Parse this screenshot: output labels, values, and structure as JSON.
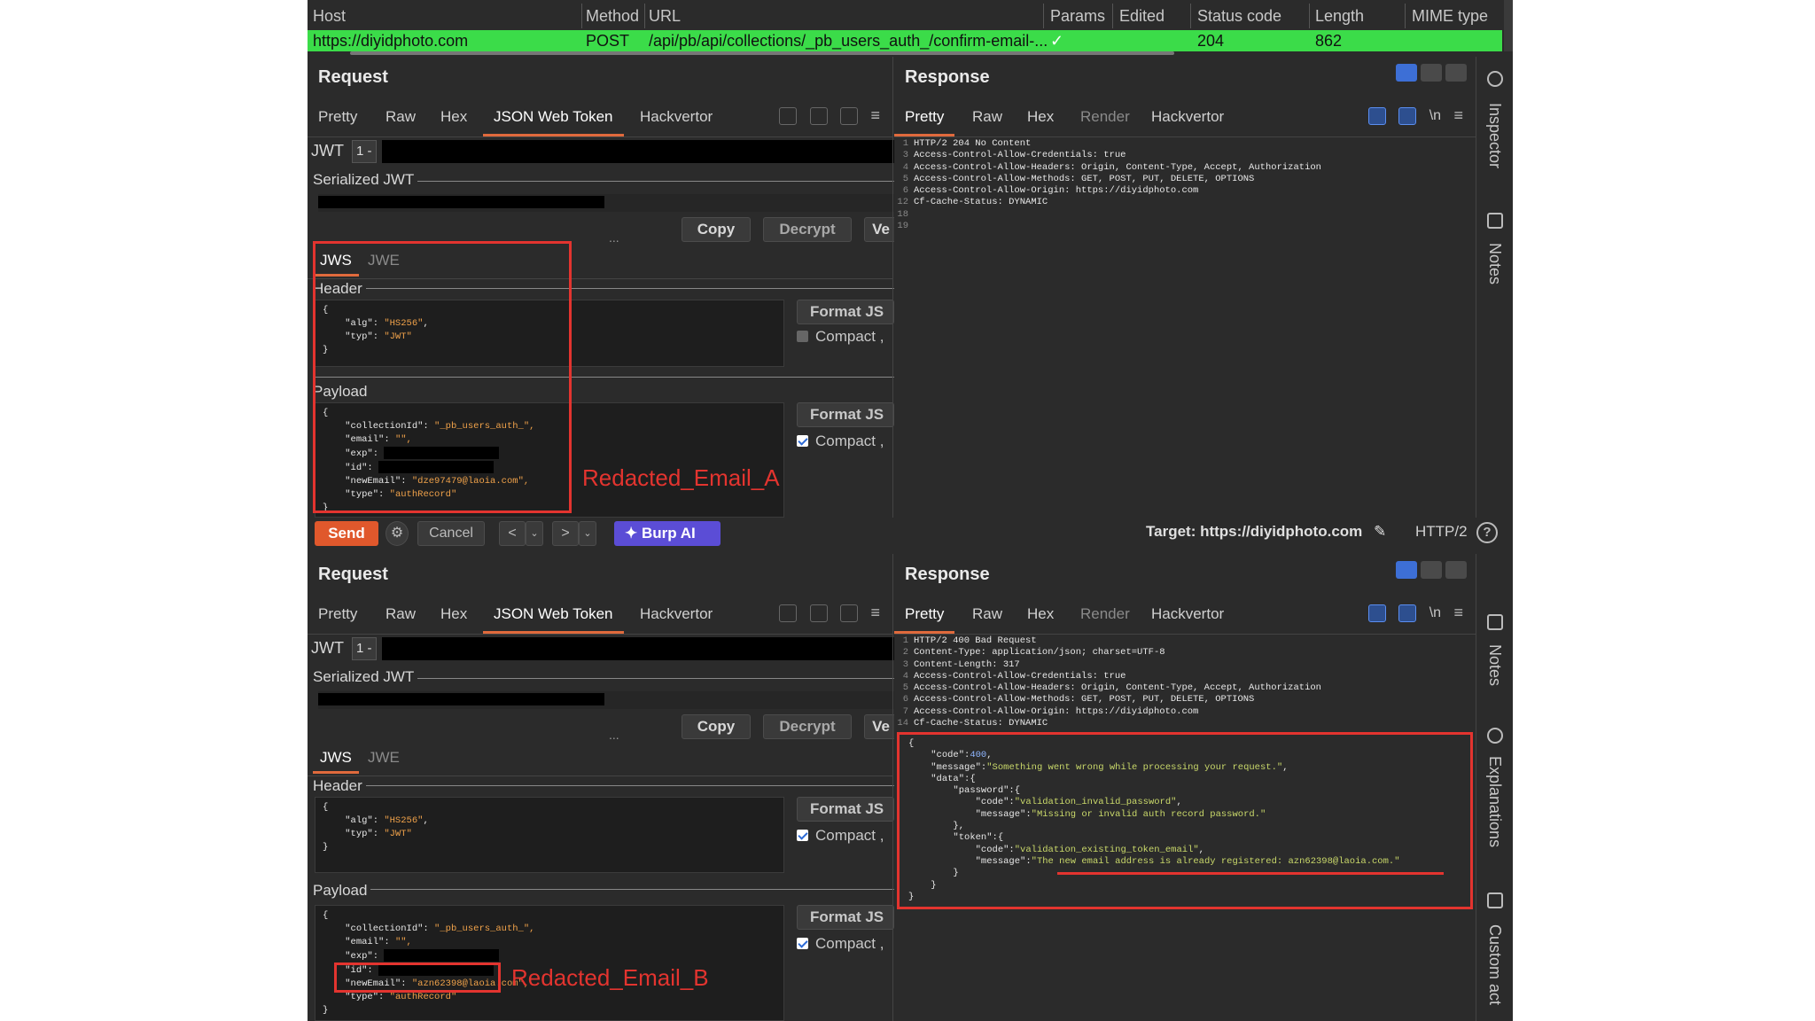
{
  "history": {
    "columns": [
      "Host",
      "Method",
      "URL",
      "Params",
      "Edited",
      "Status code",
      "Length",
      "MIME type"
    ],
    "row": {
      "host": "https://diyidphoto.com",
      "method": "POST",
      "url": "/api/pb/api/collections/_pb_users_auth_/confirm-email-...",
      "params": "✓",
      "status": "204",
      "length": "862"
    }
  },
  "editor": {
    "request_title": "Request",
    "response_title": "Response",
    "request_tabs": [
      "Pretty",
      "Raw",
      "Hex",
      "JSON Web Token",
      "Hackvertor"
    ],
    "response_tabs": [
      "Pretty",
      "Raw",
      "Hex",
      "Render",
      "Hackvertor"
    ],
    "newline_label": "\\n",
    "jwt_label": "JWT",
    "jwt_select": "1 -",
    "serialized_label": "Serialized JWT",
    "copy": "Copy",
    "decrypt": "Decrypt",
    "verify_partial": "Ve",
    "subtab_jws": "JWS",
    "subtab_jwe": "JWE",
    "header_label": "Header",
    "payload_label": "Payload",
    "format_label": "Format JS",
    "compact_label": "Compact ,",
    "handle": "..."
  },
  "top": {
    "header_lines": [
      "{",
      "    \"alg\": \"HS256\",",
      "    \"typ\": \"JWT\"",
      "}"
    ],
    "payload": {
      "collectionId": "\"_pb_users_auth_\",",
      "email": "\"\",",
      "newEmail": "\"dze97479@laoia.com\",",
      "type": "\"authRecord\""
    },
    "response_lines": [
      {
        "n": "1",
        "t": "HTTP/2 204 No Content"
      },
      {
        "n": "3",
        "t": "Access-Control-Allow-Credentials: true"
      },
      {
        "n": "4",
        "t": "Access-Control-Allow-Headers: Origin, Content-Type, Accept, Authorization"
      },
      {
        "n": "5",
        "t": "Access-Control-Allow-Methods: GET, POST, PUT, DELETE, OPTIONS"
      },
      {
        "n": "6",
        "t": "Access-Control-Allow-Origin: https://diyidphoto.com"
      },
      {
        "n": "12",
        "t": "Cf-Cache-Status: DYNAMIC"
      },
      {
        "n": "18",
        "t": ""
      },
      {
        "n": "19",
        "t": ""
      }
    ],
    "annotation": "Redacted_Email_A"
  },
  "toolbar": {
    "send": "Send",
    "cancel": "Cancel",
    "burp_ai": "Burp AI",
    "target": "Target: https://diyidphoto.com",
    "http": "HTTP/2",
    "help": "?"
  },
  "bottom": {
    "header_lines": [
      "{",
      "    \"alg\": \"HS256\",",
      "    \"typ\": \"JWT\"",
      "}"
    ],
    "payload": {
      "collectionId": "\"_pb_users_auth_\",",
      "email": "\"\",",
      "newEmail": "\"azn62398@laoia.com\",",
      "type": "\"authRecord\""
    },
    "response_headers": [
      {
        "n": "1",
        "t": "HTTP/2 400 Bad Request"
      },
      {
        "n": "2",
        "t": "Content-Type: application/json; charset=UTF-8"
      },
      {
        "n": "3",
        "t": "Content-Length: 317"
      },
      {
        "n": "4",
        "t": "Access-Control-Allow-Credentials: true"
      },
      {
        "n": "5",
        "t": "Access-Control-Allow-Headers: Origin, Content-Type, Accept, Authorization"
      },
      {
        "n": "6",
        "t": "Access-Control-Allow-Methods: GET, POST, PUT, DELETE, OPTIONS"
      },
      {
        "n": "7",
        "t": "Access-Control-Allow-Origin: https://diyidphoto.com"
      },
      {
        "n": "14",
        "t": "Cf-Cache-Status: DYNAMIC"
      }
    ],
    "body": {
      "code": "400",
      "message": "\"Something went wrong while processing your request.\"",
      "password_code": "\"validation_invalid_password\"",
      "password_message": "\"Missing or invalid auth record password.\"",
      "token_code": "\"validation_existing_token_email\"",
      "token_message": "\"The new email address is already registered: azn62398@laoia.com.\""
    },
    "annotation": "Redacted_Email_B"
  },
  "sidebar": {
    "inspector": "Inspector",
    "notes": "Notes",
    "explanations": "Explanations",
    "custom": "Custom act"
  }
}
